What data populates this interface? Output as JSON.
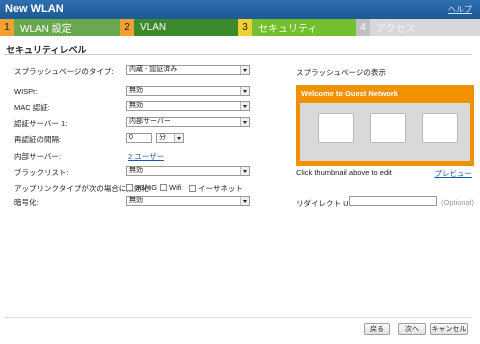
{
  "window": {
    "title": "New WLAN",
    "help_link": "ヘルプ"
  },
  "steps": [
    {
      "num": "1",
      "label": "WLAN 設定"
    },
    {
      "num": "2",
      "label": "VLAN"
    },
    {
      "num": "3",
      "label": "セキュリティ"
    },
    {
      "num": "4",
      "label": "アクセス"
    }
  ],
  "section_title": "セキュリティレベル",
  "form": {
    "splash_type": {
      "label": "スプラッシュページのタイプ:",
      "value": "内蔵 - 認証済み"
    },
    "wispr": {
      "label": "WISPr:",
      "value": "無効"
    },
    "mac_auth": {
      "label": "MAC 認証:",
      "value": "無効"
    },
    "auth_server": {
      "label": "認証サーバー 1:",
      "value": "内部サーバー"
    },
    "reauth": {
      "label": "再認証の間隔:",
      "value": "0",
      "unit": "分"
    },
    "internal_server": {
      "label": "内部サーバー:",
      "link": "2 ユーザー"
    },
    "blacklist": {
      "label": "ブラックリスト:",
      "value": "無効"
    },
    "disable_if_uplink": {
      "label": "アップリンクタイプが次の場合に無効化:",
      "options": [
        "3G/4G",
        "Wifi",
        "イーサネット"
      ]
    },
    "encryption": {
      "label": "暗号化:",
      "value": "無効"
    }
  },
  "preview": {
    "label": "スプラッシュページの表示",
    "header": "Welcome to Guest Network",
    "hint": "Click thumbnail above to edit",
    "preview_link": "プレビュー"
  },
  "redirect": {
    "label": "リダイレクト URL:",
    "placeholder": "(Optional)"
  },
  "buttons": {
    "back": "戻る",
    "next": "次へ",
    "cancel": "キャンセル"
  }
}
